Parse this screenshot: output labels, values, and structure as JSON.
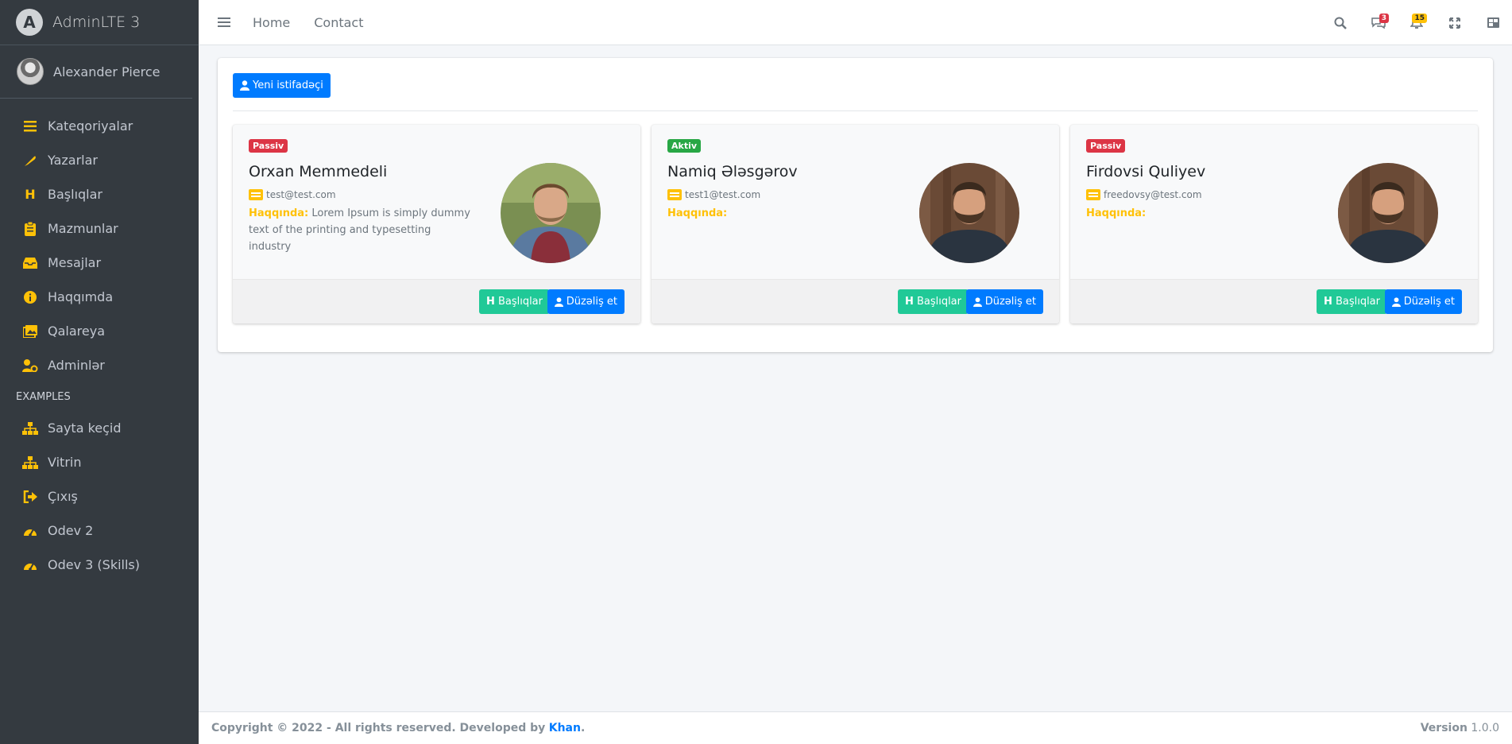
{
  "brand": {
    "logo_letter": "A",
    "name": "AdminLTE 3"
  },
  "user": {
    "name": "Alexander Pierce"
  },
  "sidebar": {
    "items": [
      {
        "label": "Kateqoriyalar",
        "icon": "list-icon",
        "glyph": "≡"
      },
      {
        "label": "Yazarlar",
        "icon": "feather-icon",
        "glyph": "✎"
      },
      {
        "label": "Başlıqlar",
        "icon": "heading-icon",
        "glyph": "H"
      },
      {
        "label": "Mazmunlar",
        "icon": "clipboard-icon",
        "glyph": "▤"
      },
      {
        "label": "Mesajlar",
        "icon": "inbox-icon",
        "glyph": "▭"
      },
      {
        "label": "Haqqımda",
        "icon": "info-icon",
        "glyph": "ℹ"
      },
      {
        "label": "Qalareya",
        "icon": "images-icon",
        "glyph": "▨"
      },
      {
        "label": "Adminlər",
        "icon": "user-cog-icon",
        "glyph": "⚙"
      }
    ],
    "header": "EXAMPLES",
    "examples": [
      {
        "label": "Sayta keçid",
        "icon": "sitemap-icon",
        "glyph": "⊞"
      },
      {
        "label": "Vitrin",
        "icon": "sitemap-icon",
        "glyph": "⊞"
      },
      {
        "label": "Çıxış",
        "icon": "sign-out-icon",
        "glyph": "⇥"
      },
      {
        "label": "Odev 2",
        "icon": "tachometer-icon",
        "glyph": "◔"
      },
      {
        "label": "Odev 3 (Skills)",
        "icon": "tachometer-icon",
        "glyph": "◔"
      }
    ]
  },
  "navbar": {
    "links": [
      "Home",
      "Contact"
    ],
    "messages_badge": "3",
    "notifications_badge": "15",
    "colors": {
      "messages_badge": "#dc3545",
      "notifications_badge": "#ffc107"
    }
  },
  "main": {
    "new_user_label": "Yeni istifadəçi",
    "cards": [
      {
        "status": "Passiv",
        "status_type": "passive",
        "name": "Orxan Memmedeli",
        "email": "test@test.com",
        "about_label": "Haqqında:",
        "about": "Lorem Ipsum is simply dummy text of the printing and typesetting industry",
        "photo": "young-man-red-hoodie"
      },
      {
        "status": "Aktiv",
        "status_type": "active",
        "name": "Namiq Ələsgərov",
        "email": "test1@test.com",
        "about_label": "Haqqında:",
        "about": "",
        "photo": "bearded-man-dark-shirt"
      },
      {
        "status": "Passiv",
        "status_type": "passive",
        "name": "Firdovsi Quliyev",
        "email": "freedovsy@test.com",
        "about_label": "Haqqında:",
        "about": "",
        "photo": "bearded-man-dark-shirt"
      }
    ],
    "headings_button": "Başlıqlar",
    "edit_button": "Düzəliş et"
  },
  "footer": {
    "copyright": "Copyright © 2022 - All rights reserved. Developed by",
    "author": "Khan",
    "version_label": "Version",
    "version": "1.0.0"
  }
}
